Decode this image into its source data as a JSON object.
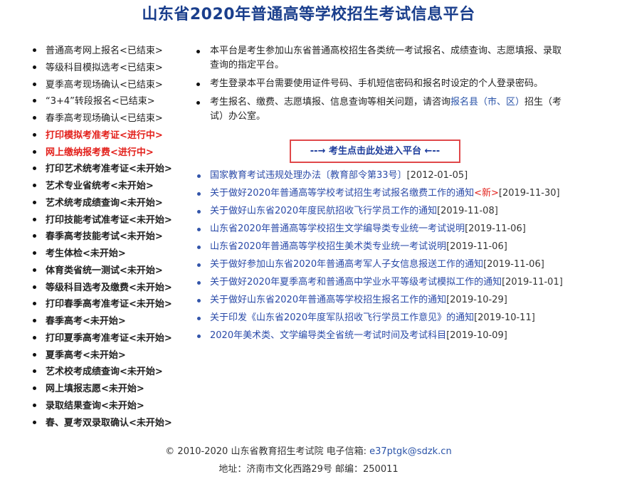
{
  "page_title": "山东省2020年普通高等学校招生考试信息平台",
  "menu": [
    {
      "label": "普通高考网上报名<已结束>",
      "style": "normal"
    },
    {
      "label": "等级科目模拟选考<已结束>",
      "style": "normal"
    },
    {
      "label": "夏季高考现场确认<已结束>",
      "style": "normal"
    },
    {
      "label": "“3+4”转段报名<已结束>",
      "style": "normal"
    },
    {
      "label": "春季高考现场确认<已结束>",
      "style": "normal"
    },
    {
      "label": "打印模拟考准考证<进行中>",
      "style": "red"
    },
    {
      "label": "网上缴纳报考费<进行中>",
      "style": "red"
    },
    {
      "label": "打印艺术统考准考证<未开始>",
      "style": "bold"
    },
    {
      "label": "艺术专业省统考<未开始>",
      "style": "bold"
    },
    {
      "label": "艺术统考成绩查询<未开始>",
      "style": "bold"
    },
    {
      "label": "打印技能考试准考证<未开始>",
      "style": "bold"
    },
    {
      "label": "春季高考技能考试<未开始>",
      "style": "bold"
    },
    {
      "label": "考生体检<未开始>",
      "style": "bold"
    },
    {
      "label": "体育类省统一测试<未开始>",
      "style": "bold"
    },
    {
      "label": "等级科目选考及缴费<未开始>",
      "style": "bold"
    },
    {
      "label": "打印春季高考准考证<未开始>",
      "style": "bold"
    },
    {
      "label": "春季高考<未开始>",
      "style": "bold"
    },
    {
      "label": "打印夏季高考准考证<未开始>",
      "style": "bold"
    },
    {
      "label": "夏季高考<未开始>",
      "style": "bold"
    },
    {
      "label": "艺术校考成绩查询<未开始>",
      "style": "bold"
    },
    {
      "label": "网上填报志愿<未开始>",
      "style": "bold"
    },
    {
      "label": "录取结果查询<未开始>",
      "style": "bold"
    },
    {
      "label": "春、夏考双录取确认<未开始>",
      "style": "bold"
    }
  ],
  "info": {
    "p1": "本平台是考生参加山东省普通高校招生各类统一考试报名、成绩查询、志愿填报、录取查询的指定平台。",
    "p2": "考生登录本平台需要使用证件号码、手机短信密码和报名时设定的个人登录密码。",
    "p3_text": "考生报名、缴费、志愿填报、信息查询等相关问题，请咨询",
    "p3_link": "报名县（市、区）",
    "p3_tail": "招生（考试）办公室。"
  },
  "enter_button": "--→ 考生点击此处进入平台 ←--",
  "news": [
    {
      "title": "国家教育考试违规处理办法〔教育部令第33号〕",
      "date": "[2012-01-05]",
      "is_new": false
    },
    {
      "title": "关于做好2020年普通高等学校考试招生考试报名缴费工作的通知",
      "date": "[2019-11-30]",
      "is_new": true,
      "new_label": "<新>"
    },
    {
      "title": "关于做好山东省2020年度民航招收飞行学员工作的通知",
      "date": "[2019-11-08]",
      "is_new": false
    },
    {
      "title": "山东省2020年普通高等学校招生文学编导类专业统一考试说明",
      "date": "[2019-11-06]",
      "is_new": false
    },
    {
      "title": "山东省2020年普通高等学校招生美术类专业统一考试说明",
      "date": "[2019-11-06]",
      "is_new": false
    },
    {
      "title": "关于做好参加山东省2020年普通高考军人子女信息报送工作的通知",
      "date": "[2019-11-06]",
      "is_new": false
    },
    {
      "title": "关于做好2020年夏季高考和普通高中学业水平等级考试模拟工作的通知",
      "date": "[2019-11-01]",
      "is_new": false
    },
    {
      "title": "关于做好山东省2020年普通高等学校招生报名工作的通知",
      "date": "[2019-10-29]",
      "is_new": false
    },
    {
      "title": "关于印发《山东省2020年度军队招收飞行学员工作意见》的通知",
      "date": "[2019-10-11]",
      "is_new": false
    },
    {
      "title": "2020年美术类、文学编导类全省统一考试时间及考试科目",
      "date": "[2019-10-09]",
      "is_new": false
    }
  ],
  "footer": {
    "copyright": "© 2010-2020",
    "org": "山东省教育招生考试院",
    "mail_label": "电子信箱:",
    "mail": "e37ptgk@sdzk.cn",
    "address": "地址：济南市文化西路29号 邮编：250011"
  }
}
